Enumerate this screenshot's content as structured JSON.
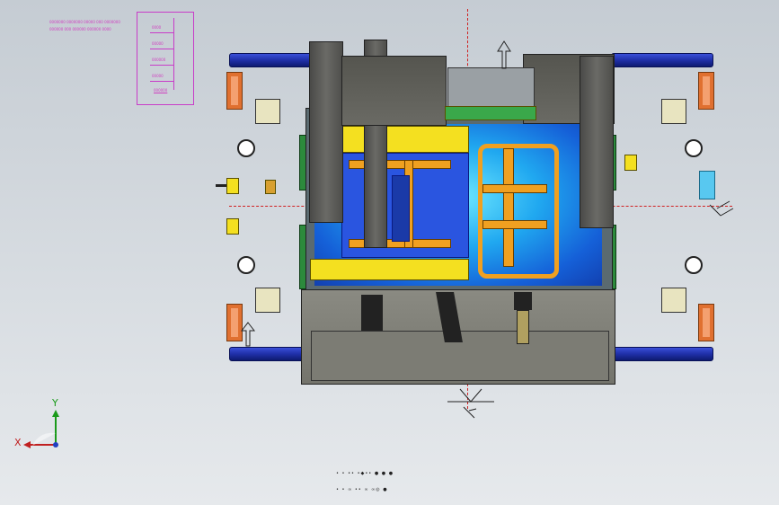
{
  "title_block": {
    "lines": [
      "0000000 0000000 00000 000 0000000",
      "000000 000 000000 000000 0000"
    ],
    "table_rows": [
      "0000",
      "00000",
      "000000",
      "00000",
      "000000"
    ]
  },
  "axes": {
    "x_label": "X",
    "y_label": "Y"
  },
  "status": {
    "row1": "• • •• •◆•• ● ● ●",
    "row2": "• • ∞ •• ∞ ∞◎ ●"
  },
  "colors": {
    "accent_magenta": "#c83cc8",
    "centerline_red": "#d02020",
    "rod_blue": "#1f2fa8",
    "core_cyan": "#20a8f0",
    "cavity_yellow": "#f4e020",
    "slide_gray": "#5a5a56"
  },
  "icons": {
    "view_triad": "axis-triad-icon",
    "up_arrow": "direction-arrow-icon",
    "surface_symbol": "surface-finish-icon"
  }
}
